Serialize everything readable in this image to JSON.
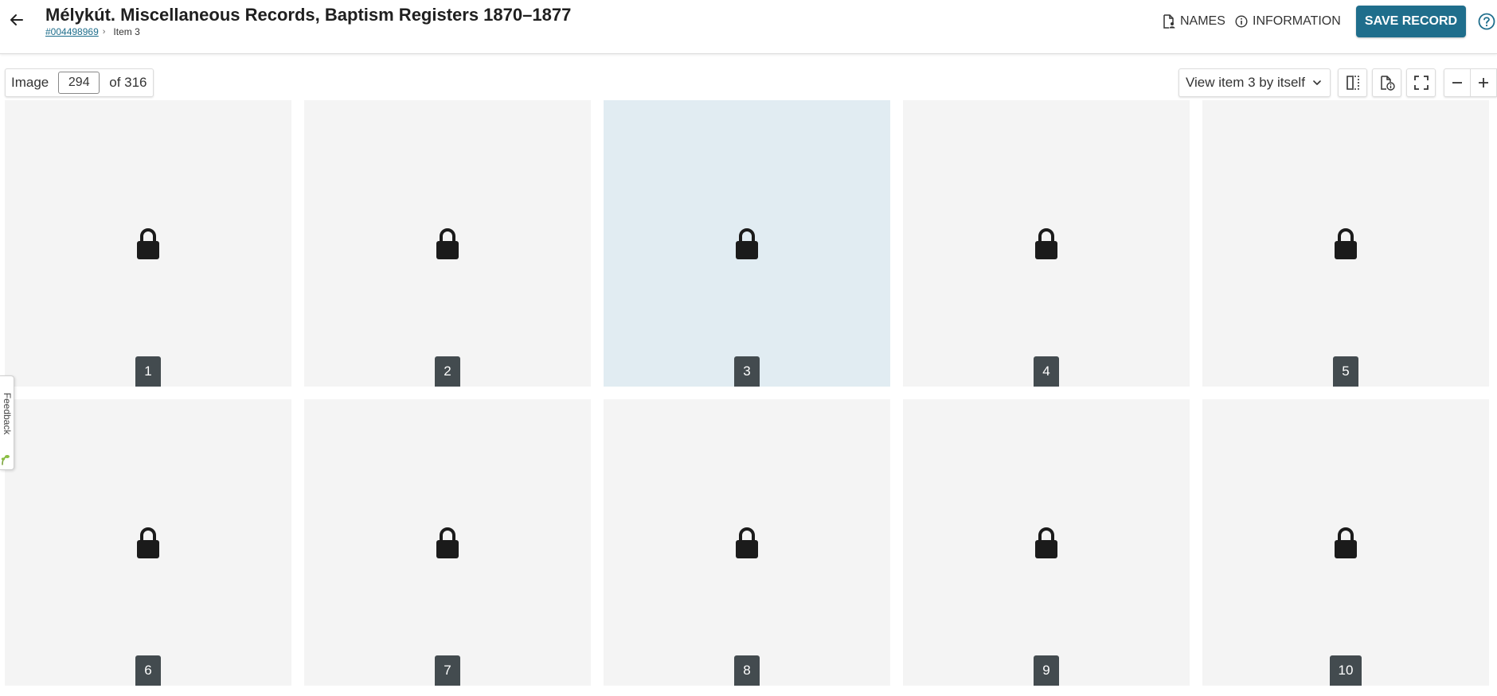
{
  "header": {
    "title": "Mélykút. Miscellaneous Records, Baptism Registers 1870–1877",
    "breadcrumb_id": "#004498969",
    "breadcrumb_sep": "›",
    "breadcrumb_current": "Item 3",
    "names_label": "NAMES",
    "info_label": "INFORMATION",
    "save_label": "SAVE RECORD",
    "accent_color": "#1f6e8c"
  },
  "toolbar": {
    "image_label": "Image",
    "image_value": "294",
    "of_label": "of 316",
    "view_select_label": "View item 3 by itself"
  },
  "grid": {
    "selected_item": "3",
    "items": [
      {
        "label": "1",
        "locked": true
      },
      {
        "label": "2",
        "locked": true
      },
      {
        "label": "3",
        "locked": true
      },
      {
        "label": "4",
        "locked": true
      },
      {
        "label": "5",
        "locked": true
      },
      {
        "label": "6",
        "locked": true
      },
      {
        "label": "7",
        "locked": true
      },
      {
        "label": "8",
        "locked": true
      },
      {
        "label": "9",
        "locked": true
      },
      {
        "label": "10",
        "locked": true
      }
    ]
  },
  "feedback": {
    "label": "Feedback"
  },
  "icons": {
    "back": "arrow-left-icon",
    "names": "document-person-icon",
    "info": "info-circle-icon",
    "help": "help-circle-icon",
    "compare": "split-view-icon",
    "record_info": "document-info-icon",
    "fullscreen": "fullscreen-icon",
    "zoom_out": "minus-icon",
    "zoom_in": "plus-icon",
    "lock": "lock-icon",
    "dropdown": "chevron-down-icon"
  }
}
